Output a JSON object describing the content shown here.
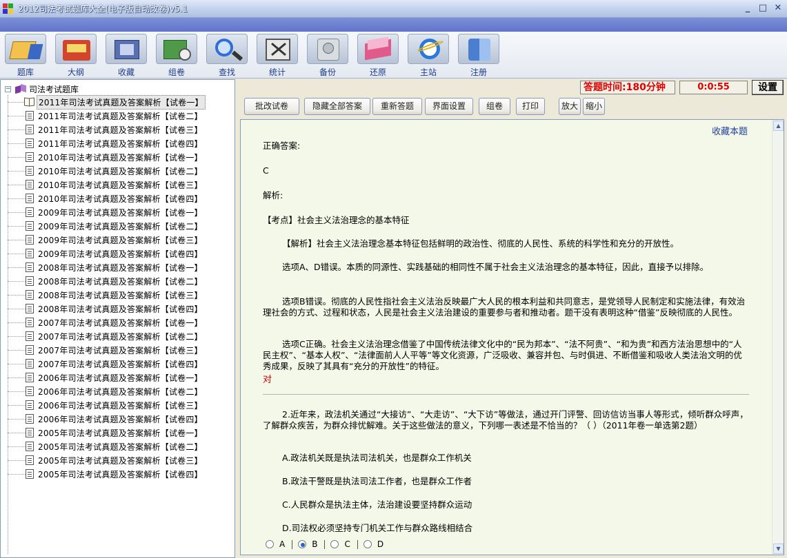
{
  "window": {
    "title": "2012司法考试题库大全(电子版自动改卷)v5.1",
    "minimize": "_",
    "maximize": "□",
    "close": "✕"
  },
  "toolbar": {
    "items": [
      {
        "label": "题库",
        "icon": "question-bank-icon",
        "color": "#f2c14e"
      },
      {
        "label": "大纲",
        "icon": "outline-book-icon",
        "color": "#d2442c"
      },
      {
        "label": "收藏",
        "icon": "favorites-icon",
        "color": "#5a6fb0"
      },
      {
        "label": "组卷",
        "icon": "compose-paper-icon",
        "color": "#4f9a48"
      },
      {
        "label": "查找",
        "icon": "search-magnifier-icon",
        "color": "#2f6fd6"
      },
      {
        "label": "统计",
        "icon": "statistics-icon",
        "color": "#555555"
      },
      {
        "label": "备份",
        "icon": "backup-disk-icon",
        "color": "#b8c0c8"
      },
      {
        "label": "还原",
        "icon": "restore-icon",
        "color": "#e05a8a"
      },
      {
        "label": "主站",
        "icon": "internet-explorer-icon",
        "color": "#2a78d8"
      },
      {
        "label": "注册",
        "icon": "register-finder-icon",
        "color": "#4a7fd0"
      }
    ]
  },
  "tree": {
    "root": "司法考试题库",
    "items": [
      "2011年司法考试真题及答案解析【试卷一】",
      "2011年司法考试真题及答案解析【试卷二】",
      "2011年司法考试真题及答案解析【试卷三】",
      "2011年司法考试真题及答案解析【试卷四】",
      "2010年司法考试真题及答案解析【试卷一】",
      "2010年司法考试真题及答案解析【试卷二】",
      "2010年司法考试真题及答案解析【试卷三】",
      "2010年司法考试真题及答案解析【试卷四】",
      "2009年司法考试真题及答案解析【试卷一】",
      "2009年司法考试真题及答案解析【试卷二】",
      "2009年司法考试真题及答案解析【试卷三】",
      "2009年司法考试真题及答案解析【试卷四】",
      "2008年司法考试真题及答案解析【试卷一】",
      "2008年司法考试真题及答案解析【试卷二】",
      "2008年司法考试真题及答案解析【试卷三】",
      "2008年司法考试真题及答案解析【试卷四】",
      "2007年司法考试真题及答案解析【试卷一】",
      "2007年司法考试真题及答案解析【试卷二】",
      "2007年司法考试真题及答案解析【试卷三】",
      "2007年司法考试真题及答案解析【试卷四】",
      "2006年司法考试真题及答案解析【试卷一】",
      "2006年司法考试真题及答案解析【试卷二】",
      "2006年司法考试真题及答案解析【试卷三】",
      "2006年司法考试真题及答案解析【试卷四】",
      "2005年司法考试真题及答案解析【试卷一】",
      "2005年司法考试真题及答案解析【试卷二】",
      "2005年司法考试真题及答案解析【试卷三】",
      "2005年司法考试真题及答案解析【试卷四】"
    ],
    "selected_index": 0
  },
  "timer": {
    "label": "答题时间:180分钟",
    "value": "0:0:55",
    "settings": "设置"
  },
  "actions": {
    "grade": "批改试卷",
    "hide_answers": "隐藏全部答案",
    "redo": "重新答题",
    "ui_settings": "界面设置",
    "compose": "组卷",
    "print": "打印",
    "zoom_in": "放大",
    "zoom_out": "缩小"
  },
  "content": {
    "favorite": "收藏本题",
    "answer_label": "正确答案:",
    "answer_value": "C",
    "analysis_label": "解析:",
    "point": "【考点】社会主义法治理念的基本特征",
    "para1": "【解析】社会主义法治理念基本特征包括鲜明的政治性、彻底的人民性、系统的科学性和充分的开放性。",
    "para2": "选项A、D错误。本质的同源性、实践基础的相同性不属于社会主义法治理念的基本特征，因此，直接予以排除。",
    "para3": "选项B错误。彻底的人民性指社会主义法治反映最广大人民的根本利益和共同意志，是党领导人民制定和实施法律，有效治理社会的方式、过程和状态，人民是社会主义法治建设的重要参与者和推动者。题干没有表明这种“借鉴”反映彻底的人民性。",
    "para4": "选项C正确。社会主义法治理念借鉴了中国传统法律文化中的“民为邦本”、“法不阿贵”、“和为贵”和西方法治思想中的“人民主权”、“基本人权”、“法律面前人人平等”等文化资源，广泛吸收、兼容并包、与时俱进、不断借鉴和吸收人类法治文明的优秀成果，反映了其具有“充分的开放性”的特征。",
    "verdict": "对",
    "q2": "2.近年来，政法机关通过“大接访”、“大走访”、“大下访”等做法，通过开门评警、回访信访当事人等形式，倾听群众呼声，了解群众疾苦，为群众排忧解难。关于这些做法的意义，下列哪一表述是不恰当的？（   ）（2011年卷一单选第2题）",
    "optA": "A.政法机关既是执法司法机关，也是群众工作机关",
    "optB": "B.政法干警既是执法司法工作者，也是群众工作者",
    "optC": "C.人民群众是执法主体，法治建设要坚持群众运动",
    "optD": "D.司法权必须坚持专门机关工作与群众路线相结合",
    "choices": [
      "A",
      "B",
      "C",
      "D"
    ],
    "selected_choice": "B",
    "verdict_color": "#d40000"
  },
  "colors": {
    "accent_red": "#e00000",
    "content_bg": "#f4f8e8",
    "link_blue": "#1e3f9c"
  }
}
